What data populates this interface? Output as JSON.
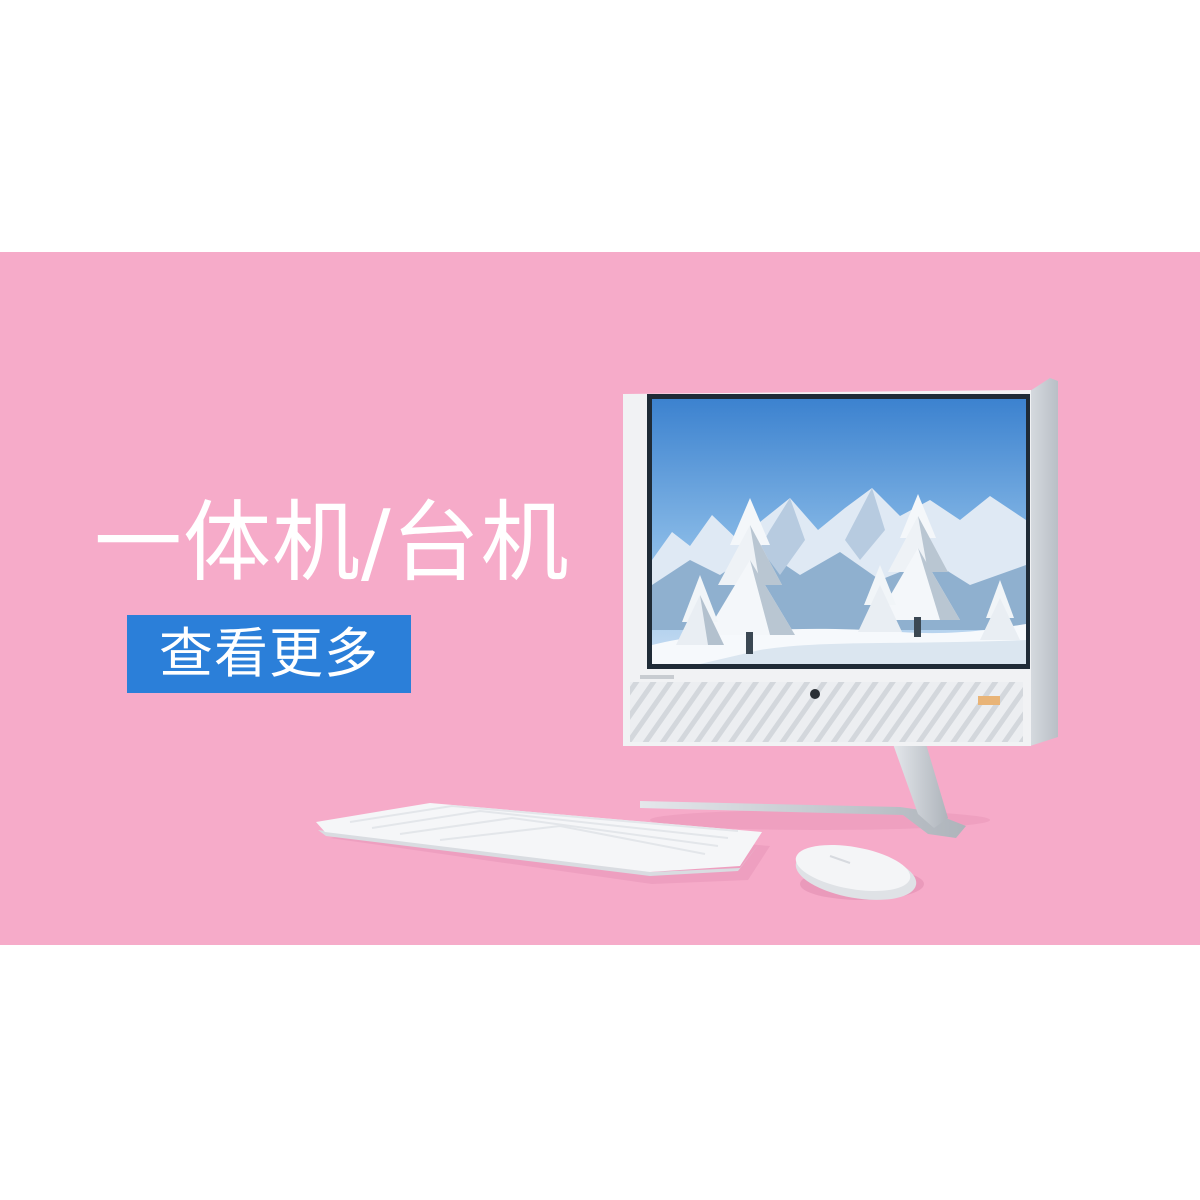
{
  "banner": {
    "title": "一体机/台机",
    "button_label": "查看更多"
  },
  "colors": {
    "banner_bg": "#f6abc9",
    "button_bg": "#2b7fd9",
    "text": "#ffffff"
  },
  "illustration": {
    "items": [
      "all-in-one-monitor",
      "keyboard",
      "mouse"
    ]
  }
}
